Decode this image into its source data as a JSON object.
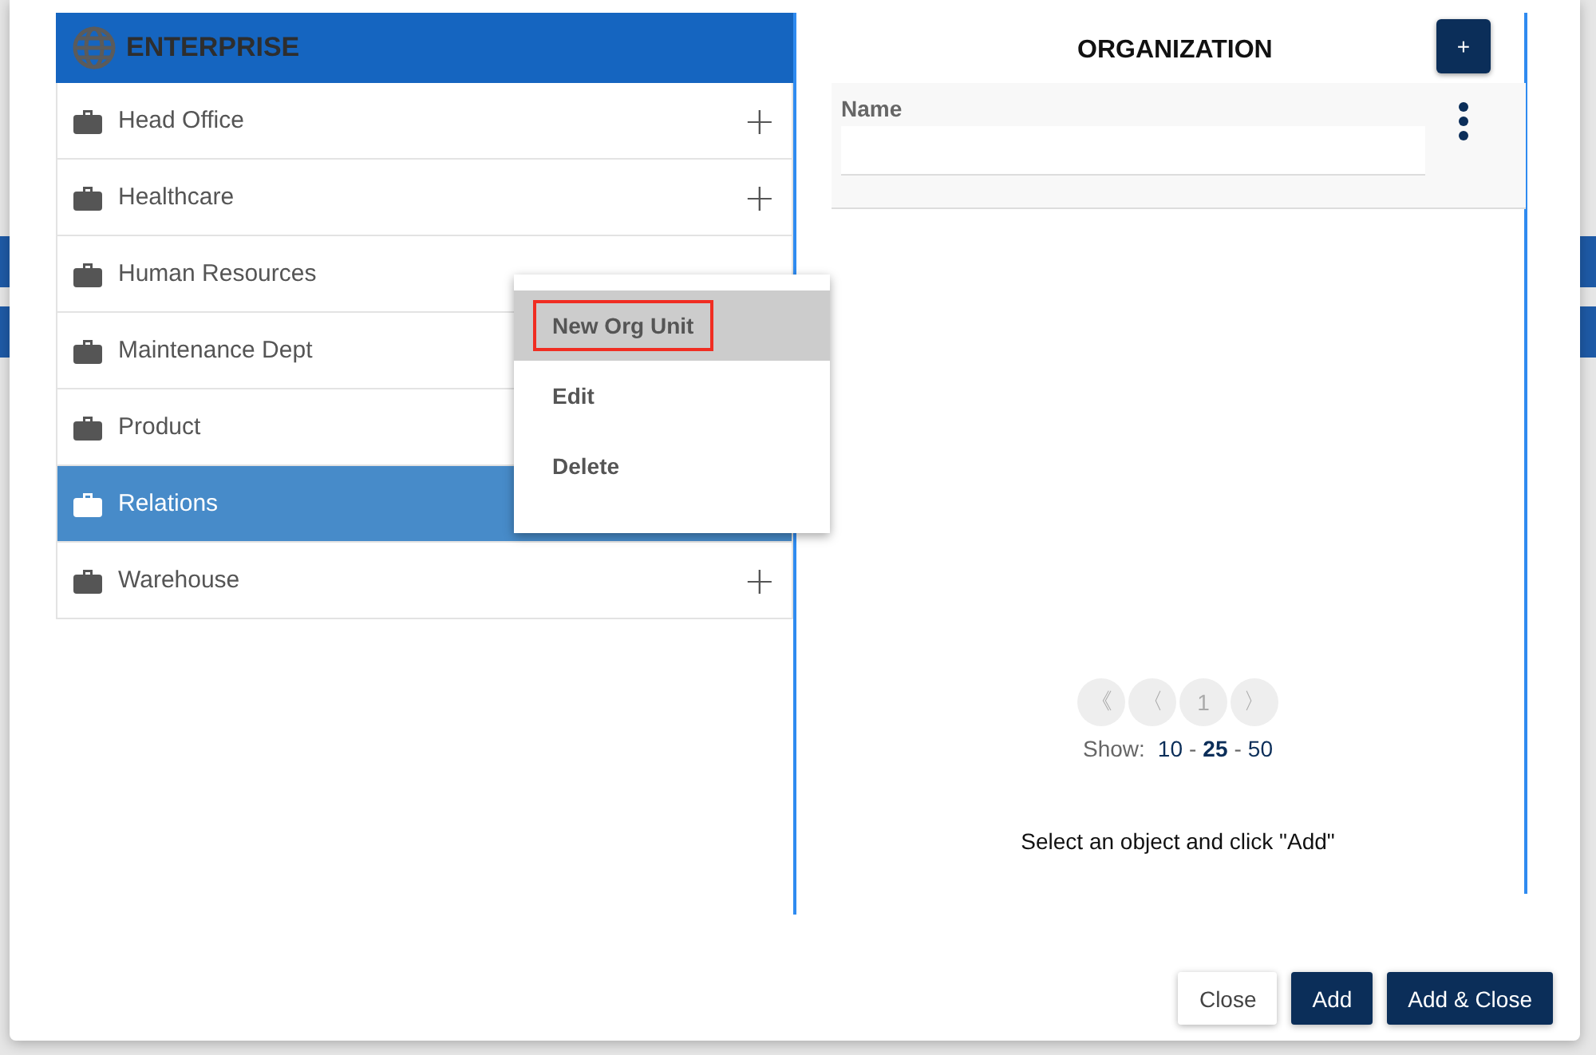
{
  "tree": {
    "root": "ENTERPRISE",
    "items": [
      {
        "label": "Head Office",
        "selected": false,
        "action": "+"
      },
      {
        "label": "Healthcare",
        "selected": false,
        "action": "+"
      },
      {
        "label": "Human Resources",
        "selected": false
      },
      {
        "label": "Maintenance Dept",
        "selected": false
      },
      {
        "label": "Product",
        "selected": false
      },
      {
        "label": "Relations",
        "selected": true
      },
      {
        "label": "Warehouse",
        "selected": false,
        "action": "+"
      }
    ]
  },
  "context_menu": [
    {
      "label": "New Org Unit",
      "selected": true,
      "annotated": true
    },
    {
      "label": "Edit",
      "selected": false,
      "annotated": false
    },
    {
      "label": "Delete",
      "selected": false,
      "annotated": false
    }
  ],
  "organization": {
    "title": "ORGANIZATION",
    "add_button": "+",
    "name_filter": {
      "label": "Name"
    },
    "pagination": {
      "buttons": [
        {
          "label": "《",
          "disabled": true
        },
        {
          "label": "〈",
          "disabled": true
        },
        {
          "label": "1",
          "disabled": true
        },
        {
          "label": "〉",
          "disabled": true
        }
      ],
      "show_label": "Show:",
      "page_sizes": [
        {
          "label": "10",
          "selected": false
        },
        {
          "label": "25",
          "selected": true
        },
        {
          "label": "50",
          "selected": false
        }
      ],
      "separator": "-"
    },
    "hint": "Select an object and click \"Add\""
  },
  "footer_buttons": [
    {
      "label": "Close",
      "kind": "secondary"
    },
    {
      "label": "Add",
      "kind": "primary"
    },
    {
      "label": "Add & Close",
      "kind": "primary"
    }
  ]
}
